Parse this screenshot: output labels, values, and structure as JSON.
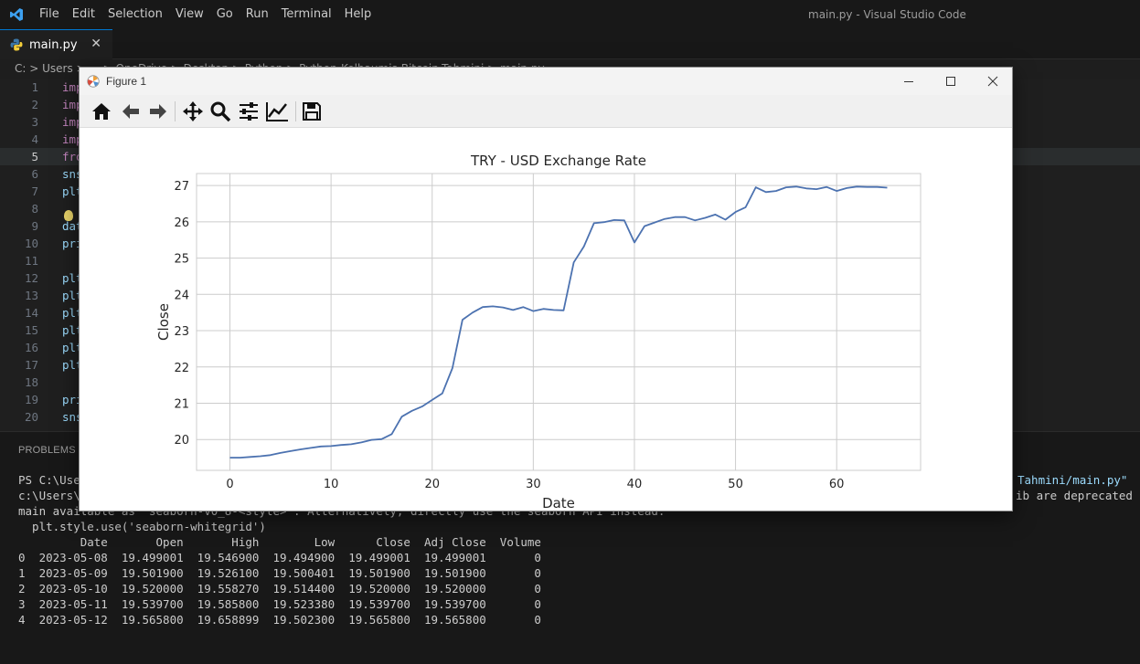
{
  "app": {
    "window_title": "main.py - Visual Studio Code",
    "menu": [
      "File",
      "Edit",
      "Selection",
      "View",
      "Go",
      "Run",
      "Terminal",
      "Help"
    ]
  },
  "tab": {
    "label": "main.py",
    "close": "✕"
  },
  "breadcrumb": {
    "text": "C: > Users > ... > OneDrive > Desktop > Python > Python-Kolbaumis-Bitcoin-Tahmini > main.py"
  },
  "editor": {
    "lines": [
      {
        "n": "1",
        "code": "imp"
      },
      {
        "n": "2",
        "code": "imp"
      },
      {
        "n": "3",
        "code": "imp"
      },
      {
        "n": "4",
        "code": "imp"
      },
      {
        "n": "5",
        "code": "fro"
      },
      {
        "n": "6",
        "code": "sns"
      },
      {
        "n": "7",
        "code": "plt"
      },
      {
        "n": "8",
        "code": ""
      },
      {
        "n": "9",
        "code": "dat"
      },
      {
        "n": "10",
        "code": "pri"
      },
      {
        "n": "11",
        "code": ""
      },
      {
        "n": "12",
        "code": "plt"
      },
      {
        "n": "13",
        "code": "plt"
      },
      {
        "n": "14",
        "code": "plt"
      },
      {
        "n": "15",
        "code": "plt"
      },
      {
        "n": "16",
        "code": "plt"
      },
      {
        "n": "17",
        "code": "plt"
      },
      {
        "n": "18",
        "code": ""
      },
      {
        "n": "19",
        "code": "pri"
      },
      {
        "n": "20",
        "code": "sns"
      }
    ],
    "current_line": "5"
  },
  "panel": {
    "tab_label": "PROBLEMS",
    "terminal": [
      "PS C:\\User",
      "c:\\Users\\",
      "main available as 'seaborn-v0_8-<style>'. Alternatively, directly use the seaborn API instead.",
      "  plt.style.use('seaborn-whitegrid')",
      "         Date       Open       High        Low      Close  Adj Close  Volume",
      "0  2023-05-08  19.499001  19.546900  19.494900  19.499001  19.499001       0",
      "1  2023-05-09  19.501900  19.526100  19.500401  19.501900  19.501900       0",
      "2  2023-05-10  19.520000  19.558270  19.514400  19.520000  19.520000       0",
      "3  2023-05-11  19.539700  19.585800  19.523380  19.539700  19.539700       0",
      "4  2023-05-12  19.565800  19.658899  19.502300  19.565800  19.565800       0"
    ],
    "right_path": "Tahmini/main.py\"",
    "right_warning": "ib are deprecated sin"
  },
  "figure": {
    "window_title": "Figure 1",
    "toolbar": [
      "home-icon",
      "back-icon",
      "forward-icon",
      "pan-icon",
      "zoom-icon",
      "configure-subplots-icon",
      "edit-axis-icon",
      "save-icon"
    ]
  },
  "colors": {
    "line": "#4c72b0",
    "grid": "#cccccc",
    "accent": "#0078d4"
  },
  "chart_data": {
    "type": "line",
    "title": "TRY - USD Exchange Rate",
    "xlabel": "Date",
    "ylabel": "Close",
    "xlim": [
      -3.3,
      68.3
    ],
    "ylim": [
      19.15,
      27.33
    ],
    "xticks": [
      0,
      10,
      20,
      30,
      40,
      50,
      60
    ],
    "yticks": [
      20,
      21,
      22,
      23,
      24,
      25,
      26,
      27
    ],
    "grid": true,
    "series": [
      {
        "x": [
          0,
          1,
          2,
          3,
          4,
          5,
          6,
          7,
          8,
          9,
          10,
          11,
          12,
          13,
          14,
          15,
          16,
          17,
          18,
          19,
          20,
          21,
          22,
          23,
          24,
          25,
          26,
          27,
          28,
          29,
          30,
          31,
          32,
          33,
          34,
          35,
          36,
          37,
          38,
          39,
          40,
          41,
          42,
          43,
          44,
          45,
          46,
          47,
          48,
          49,
          50,
          51,
          52,
          53,
          54,
          55,
          56,
          57,
          58,
          59,
          60,
          61,
          62,
          63,
          64,
          65
        ],
        "values": [
          19.5,
          19.5,
          19.52,
          19.54,
          19.57,
          19.63,
          19.68,
          19.73,
          19.77,
          19.81,
          19.82,
          19.85,
          19.87,
          19.92,
          19.99,
          20.01,
          20.15,
          20.63,
          20.79,
          20.91,
          21.09,
          21.27,
          21.97,
          23.3,
          23.5,
          23.65,
          23.67,
          23.64,
          23.57,
          23.65,
          23.54,
          23.6,
          23.57,
          23.56,
          24.88,
          25.32,
          25.96,
          25.99,
          26.05,
          26.04,
          25.43,
          25.88,
          25.98,
          26.08,
          26.13,
          26.13,
          26.04,
          26.11,
          26.2,
          26.06,
          26.27,
          26.4,
          26.95,
          26.82,
          26.85,
          26.95,
          26.97,
          26.92,
          26.9,
          26.96,
          26.85,
          26.93,
          26.97,
          26.96,
          26.96,
          26.94
        ]
      }
    ]
  }
}
